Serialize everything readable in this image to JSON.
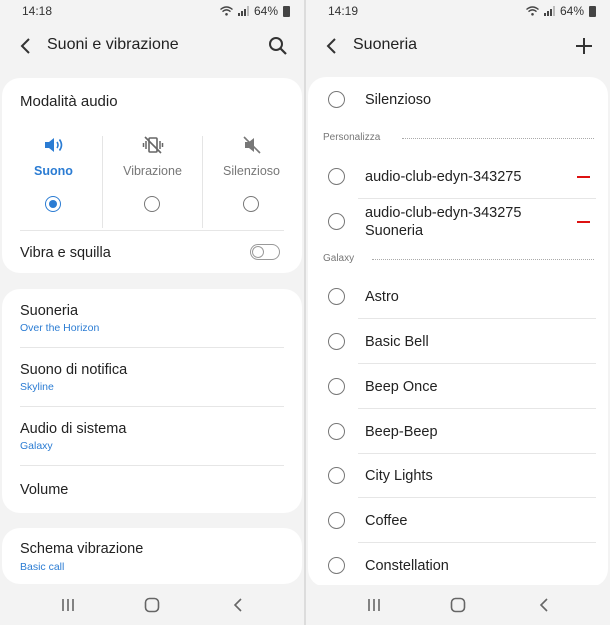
{
  "left_screen": {
    "status": {
      "time": "14:18",
      "battery": "64%"
    },
    "appbar": {
      "title": "Suoni e vibrazione",
      "back_icon": "back-arrow-icon",
      "action_icon": "search-icon"
    },
    "audio_mode": {
      "title": "Modalità audio",
      "options": [
        {
          "label": "Suono",
          "selected": true,
          "icon": "speaker-icon"
        },
        {
          "label": "Vibrazione",
          "selected": false,
          "icon": "vibrate-icon"
        },
        {
          "label": "Silenzioso",
          "selected": false,
          "icon": "mute-icon"
        }
      ],
      "vibrate_ring_label": "Vibra e squilla",
      "vibrate_ring_on": false
    },
    "settings": [
      {
        "title": "Suoneria",
        "sub": "Over the Horizon"
      },
      {
        "title": "Suono di notifica",
        "sub": "Skyline"
      },
      {
        "title": "Audio di sistema",
        "sub": "Galaxy"
      },
      {
        "title": "Volume",
        "sub": ""
      }
    ],
    "vibration": {
      "title": "Schema vibrazione",
      "sub": "Basic call"
    }
  },
  "right_screen": {
    "status": {
      "time": "14:19",
      "battery": "64%"
    },
    "appbar": {
      "title": "Suoneria",
      "back_icon": "back-arrow-icon",
      "action_icon": "plus-icon"
    },
    "silent_label": "Silenzioso",
    "custom_section": "Personalizza",
    "custom": [
      {
        "label": "audio-club-edyn-343275",
        "removable": true
      },
      {
        "label": "audio-club-edyn-343275\nSuoneria",
        "removable": true
      }
    ],
    "galaxy_section": "Galaxy",
    "galaxy": [
      "Astro",
      "Basic Bell",
      "Beep Once",
      "Beep-Beep",
      "City Lights",
      "Coffee",
      "Constellation"
    ]
  },
  "colors": {
    "accent": "#2b7cd3",
    "remove": "#dd1111",
    "background": "#f3f3f3",
    "card": "#ffffff"
  }
}
